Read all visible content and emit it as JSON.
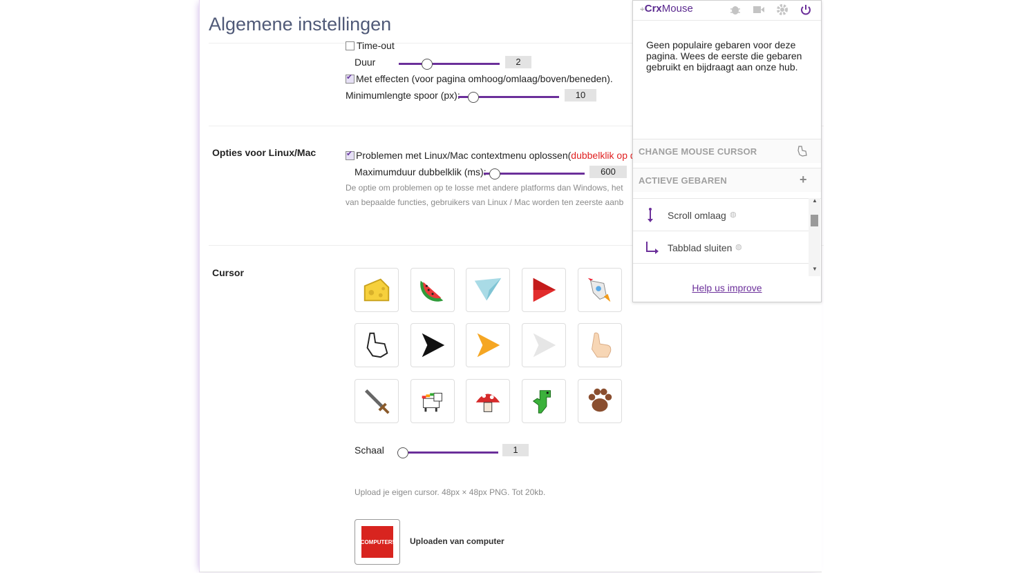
{
  "page": {
    "title": "Algemene instellingen",
    "timeout_label": "Time-out",
    "duur_label": "Duur",
    "duur_value": "2",
    "effects_label": "Met effecten (voor pagina omhoog/omlaag/boven/beneden).",
    "minlength_label": "Minimumlengte spoor (px):",
    "minlength_value": "10",
    "linux_section": "Opties voor Linux/Mac",
    "linux_fix_label": "Problemen met Linux/Mac contextmenu oplossen(",
    "linux_fix_red": "dubbelklik op de",
    "maxdouble_label": "Maximumduur dubbelklik (ms):",
    "maxdouble_value": "600",
    "linux_desc_1": "De optie om problemen op te losse met andere platforms dan Windows, het",
    "linux_desc_2": "van bepaalde functies, gebruikers van Linux / Mac worden ten zeerste aanb",
    "cursor_section": "Cursor",
    "scale_label": "Schaal",
    "scale_value": "1",
    "upload_hint": "Upload je eigen cursor. 48px × 48px PNG. Tot 20kb.",
    "upload_button": "Uploaden van computer",
    "upload_logo_text": "COMPUTER!",
    "cursors": [
      "cheese-cursor",
      "watermelon-cursor",
      "paper-plane-cursor",
      "red-arrow-cursor",
      "rocket-cursor",
      "pixel-hand-cursor",
      "black-arrow-cursor",
      "orange-arrow-cursor",
      "white-arrow-cursor",
      "hand-pointer-cursor",
      "sword-cursor",
      "unicorn-cursor",
      "mushroom-cursor",
      "dinosaur-cursor",
      "paw-cursor"
    ]
  },
  "popup": {
    "logo_prefix": "Crx",
    "logo_suffix": "Mouse",
    "message": "Geen populaire gebaren voor deze pagina. Wees de eerste die gebaren gebruikt en bijdraagt aan onze hub.",
    "change_cursor": "CHANGE MOUSE CURSOR",
    "active_gestures": "ACTIEVE GEBAREN",
    "gestures": [
      {
        "label": "Scroll omlaag",
        "icon": "arrow-down-icon"
      },
      {
        "label": "Tabblad sluiten",
        "icon": "down-right-icon"
      }
    ],
    "help": "Help us improve"
  },
  "colors": {
    "accent": "#6b2f9a",
    "title": "#505a78",
    "red": "#e02020"
  }
}
